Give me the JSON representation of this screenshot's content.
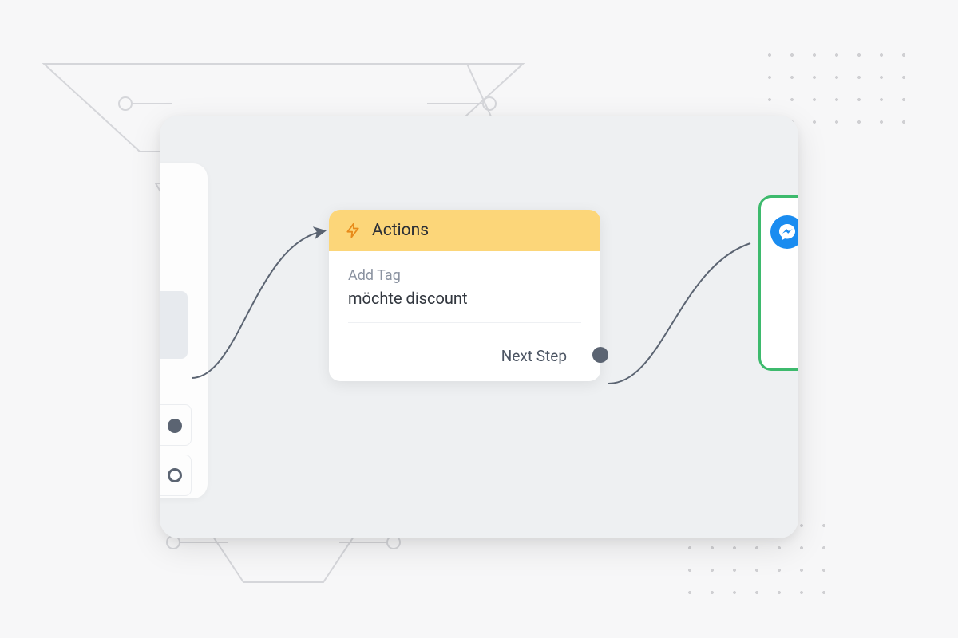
{
  "canvas": {
    "actions_card": {
      "title": "Actions",
      "tag_label": "Add Tag",
      "tag_value": "möchte discount",
      "next_step_label": "Next Step"
    },
    "icons": {
      "bolt": "bolt-icon",
      "messenger": "messenger-icon"
    },
    "colors": {
      "header_bg": "#fcd679",
      "bolt": "#e88b1a",
      "port": "#5b6472",
      "right_border": "#3dba6d",
      "messenger": "#1a8cf0"
    }
  }
}
